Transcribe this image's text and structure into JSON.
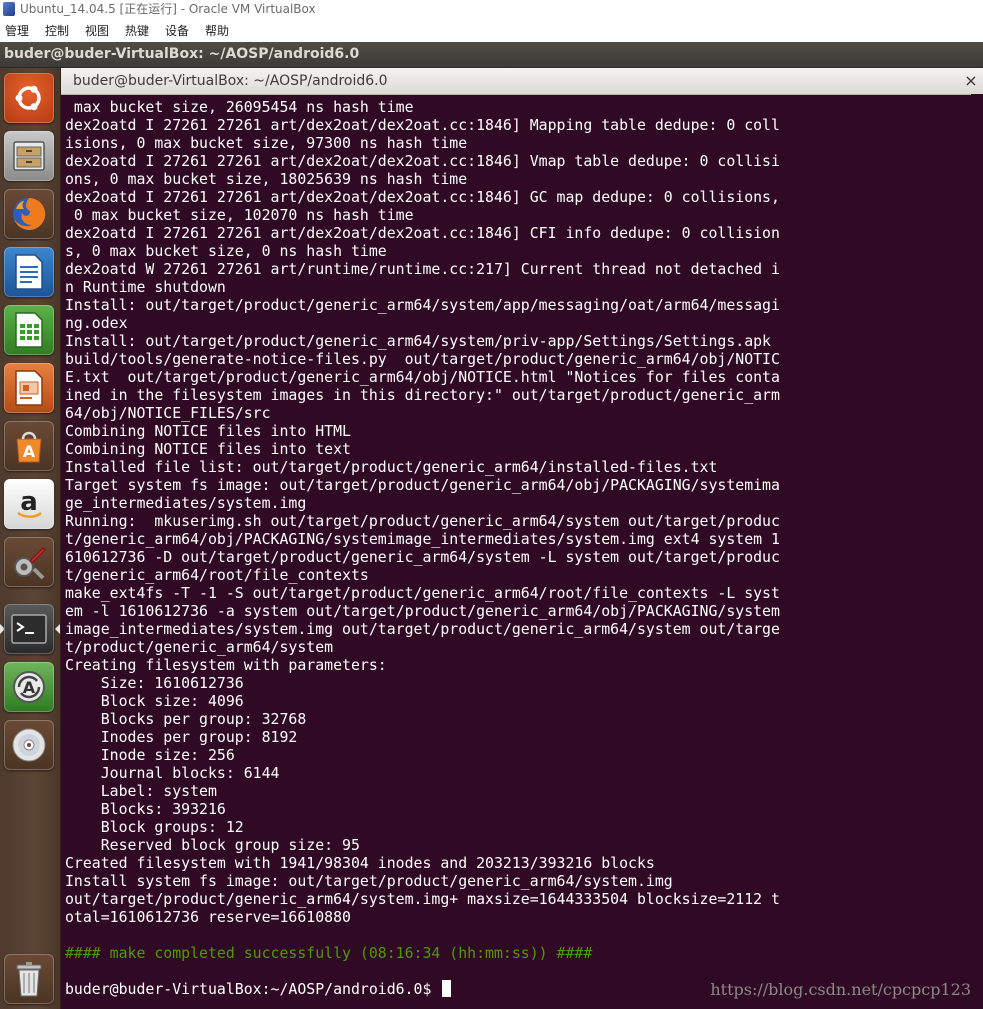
{
  "vbox": {
    "title": "Ubuntu_14.04.5 [正在运行] - Oracle VM VirtualBox",
    "menu": [
      "管理",
      "控制",
      "视图",
      "热键",
      "设备",
      "帮助"
    ]
  },
  "panel": {
    "title": "buder@buder-VirtualBox: ~/AOSP/android6.0"
  },
  "launcher": {
    "items": [
      {
        "name": "ubuntu-dash-icon",
        "color": "#c44520"
      },
      {
        "name": "files-icon",
        "color": "#8c8c8c"
      },
      {
        "name": "firefox-icon",
        "color": "#e66000"
      },
      {
        "name": "libreoffice-writer-icon",
        "color": "#2a6fb6"
      },
      {
        "name": "libreoffice-calc-icon",
        "color": "#3c9a2a"
      },
      {
        "name": "libreoffice-impress-icon",
        "color": "#d25f1c"
      },
      {
        "name": "software-center-icon",
        "color": "#e07a1f"
      },
      {
        "name": "amazon-icon",
        "color": "#f2f2f2"
      },
      {
        "name": "system-settings-icon",
        "color": "#9a9a9a"
      },
      {
        "name": "terminal-icon",
        "color": "#3a3a3a"
      },
      {
        "name": "software-updater-icon",
        "color": "#4a8f3a"
      },
      {
        "name": "dvd-icon",
        "color": "#c8c8c8"
      },
      {
        "name": "trash-icon",
        "color": "#6c6c6c"
      }
    ]
  },
  "terminal": {
    "title": "buder@buder-VirtualBox: ~/AOSP/android6.0",
    "close_label": "×",
    "background": "#300a24",
    "success_color": "#4e9a06",
    "lines": [
      " max bucket size, 26095454 ns hash time",
      "dex2oatd I 27261 27261 art/dex2oat/dex2oat.cc:1846] Mapping table dedupe: 0 coll",
      "isions, 0 max bucket size, 97300 ns hash time",
      "dex2oatd I 27261 27261 art/dex2oat/dex2oat.cc:1846] Vmap table dedupe: 0 collisi",
      "ons, 0 max bucket size, 18025639 ns hash time",
      "dex2oatd I 27261 27261 art/dex2oat/dex2oat.cc:1846] GC map dedupe: 0 collisions,",
      " 0 max bucket size, 102070 ns hash time",
      "dex2oatd I 27261 27261 art/dex2oat/dex2oat.cc:1846] CFI info dedupe: 0 collision",
      "s, 0 max bucket size, 0 ns hash time",
      "dex2oatd W 27261 27261 art/runtime/runtime.cc:217] Current thread not detached i",
      "n Runtime shutdown",
      "Install: out/target/product/generic_arm64/system/app/messaging/oat/arm64/messagi",
      "ng.odex",
      "Install: out/target/product/generic_arm64/system/priv-app/Settings/Settings.apk",
      "build/tools/generate-notice-files.py  out/target/product/generic_arm64/obj/NOTIC",
      "E.txt  out/target/product/generic_arm64/obj/NOTICE.html \"Notices for files conta",
      "ined in the filesystem images in this directory:\" out/target/product/generic_arm",
      "64/obj/NOTICE_FILES/src",
      "Combining NOTICE files into HTML",
      "Combining NOTICE files into text",
      "Installed file list: out/target/product/generic_arm64/installed-files.txt",
      "Target system fs image: out/target/product/generic_arm64/obj/PACKAGING/systemima",
      "ge_intermediates/system.img",
      "Running:  mkuserimg.sh out/target/product/generic_arm64/system out/target/produc",
      "t/generic_arm64/obj/PACKAGING/systemimage_intermediates/system.img ext4 system 1",
      "610612736 -D out/target/product/generic_arm64/system -L system out/target/produc",
      "t/generic_arm64/root/file_contexts",
      "make_ext4fs -T -1 -S out/target/product/generic_arm64/root/file_contexts -L syst",
      "em -l 1610612736 -a system out/target/product/generic_arm64/obj/PACKAGING/system",
      "image_intermediates/system.img out/target/product/generic_arm64/system out/targe",
      "t/product/generic_arm64/system",
      "Creating filesystem with parameters:",
      "    Size: 1610612736",
      "    Block size: 4096",
      "    Blocks per group: 32768",
      "    Inodes per group: 8192",
      "    Inode size: 256",
      "    Journal blocks: 6144",
      "    Label: system",
      "    Blocks: 393216",
      "    Block groups: 12",
      "    Reserved block group size: 95",
      "Created filesystem with 1941/98304 inodes and 203213/393216 blocks",
      "Install system fs image: out/target/product/generic_arm64/system.img",
      "out/target/product/generic_arm64/system.img+ maxsize=1644333504 blocksize=2112 t",
      "otal=1610612736 reserve=16610880",
      "",
      "#### make completed successfully (08:16:34 (hh:mm:ss)) ####",
      "",
      "buder@buder-VirtualBox:~/AOSP/android6.0$ "
    ],
    "success_line_index": 47
  },
  "watermark": "https://blog.csdn.net/cpcpcp123"
}
